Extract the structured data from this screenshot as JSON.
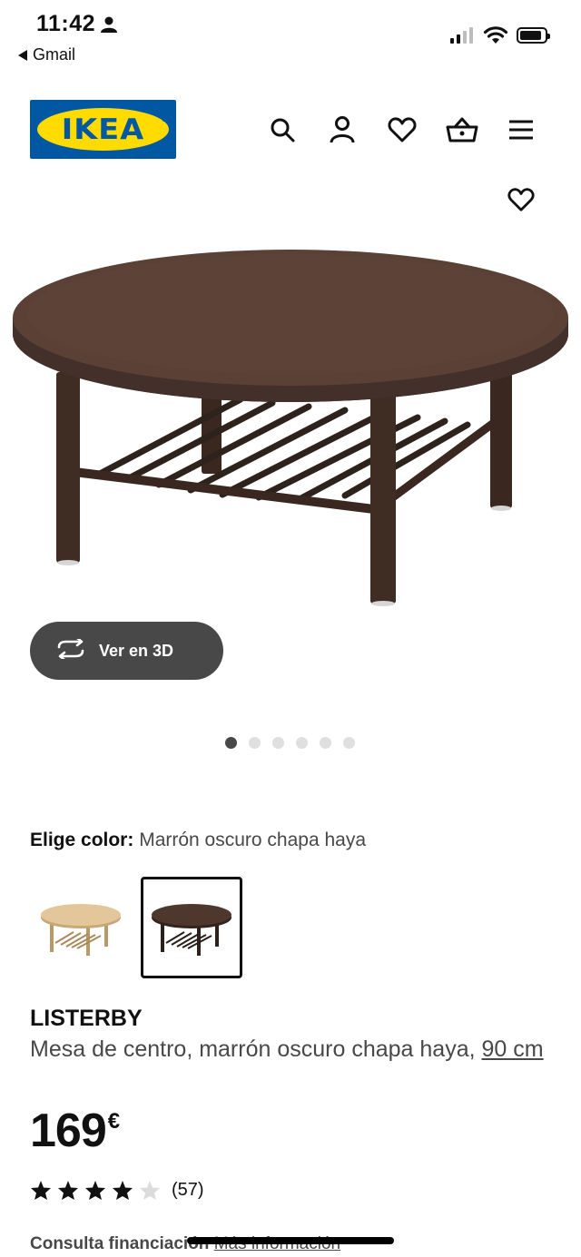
{
  "status_bar": {
    "time": "11:42",
    "back_app": "Gmail"
  },
  "header": {
    "logo_text": "IKEA",
    "icons": [
      "search-icon",
      "user-icon",
      "heart-icon",
      "basket-icon",
      "menu-icon"
    ]
  },
  "gallery": {
    "view_3d_label": "Ver en 3D",
    "image_count": 6,
    "active_index": 0
  },
  "color_picker": {
    "label": "Elige color:",
    "selected_value": "Marrón oscuro chapa haya",
    "options": [
      "light-beech-option",
      "dark-brown-option"
    ]
  },
  "product": {
    "name": "LISTERBY",
    "description": "Mesa de centro, marrón oscuro chapa haya,",
    "size": "90 cm",
    "price": "169",
    "currency": "€",
    "rating": 4,
    "rating_max": 5,
    "review_count": "(57)"
  },
  "finance": {
    "label": "Consulta financiación",
    "more_link": "Más información"
  },
  "colors": {
    "ikea_blue": "#0058a3",
    "ikea_yellow": "#ffdb00",
    "button_dark": "#484848",
    "table_brown": "#4a3529"
  }
}
